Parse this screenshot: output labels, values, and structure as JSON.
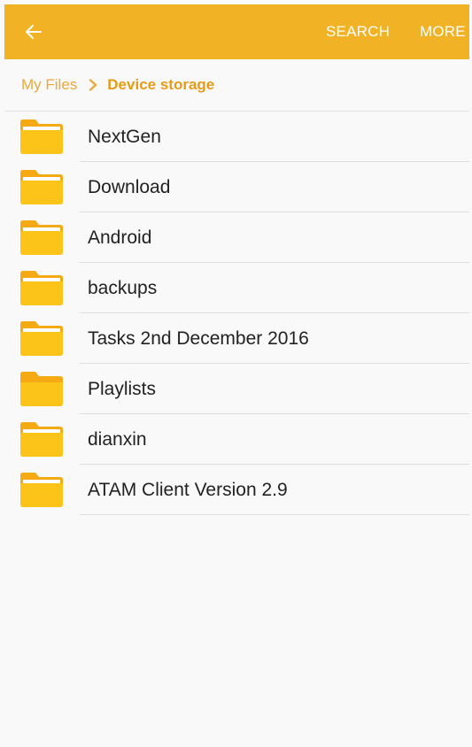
{
  "appbar": {
    "back_icon": "arrow-left-icon",
    "search_label": "SEARCH",
    "more_label": "MORE"
  },
  "breadcrumb": {
    "root": "My Files",
    "separator_icon": "chevron-right-icon",
    "current": "Device storage"
  },
  "folders": [
    {
      "name": "NextGen",
      "icon": "folder-icon"
    },
    {
      "name": "Download",
      "icon": "folder-icon"
    },
    {
      "name": "Android",
      "icon": "folder-icon"
    },
    {
      "name": "backups",
      "icon": "folder-icon"
    },
    {
      "name": "Tasks 2nd December 2016",
      "icon": "folder-icon"
    },
    {
      "name": "Playlists",
      "icon": "folder-icon"
    },
    {
      "name": "dianxin",
      "icon": "folder-icon"
    },
    {
      "name": "ATAM Client Version 2.9",
      "icon": "folder-icon"
    }
  ],
  "colors": {
    "appbar": "#f1b325",
    "accent": "#e39c16",
    "folder_body": "#fcc419",
    "folder_tab": "#f5a913"
  }
}
